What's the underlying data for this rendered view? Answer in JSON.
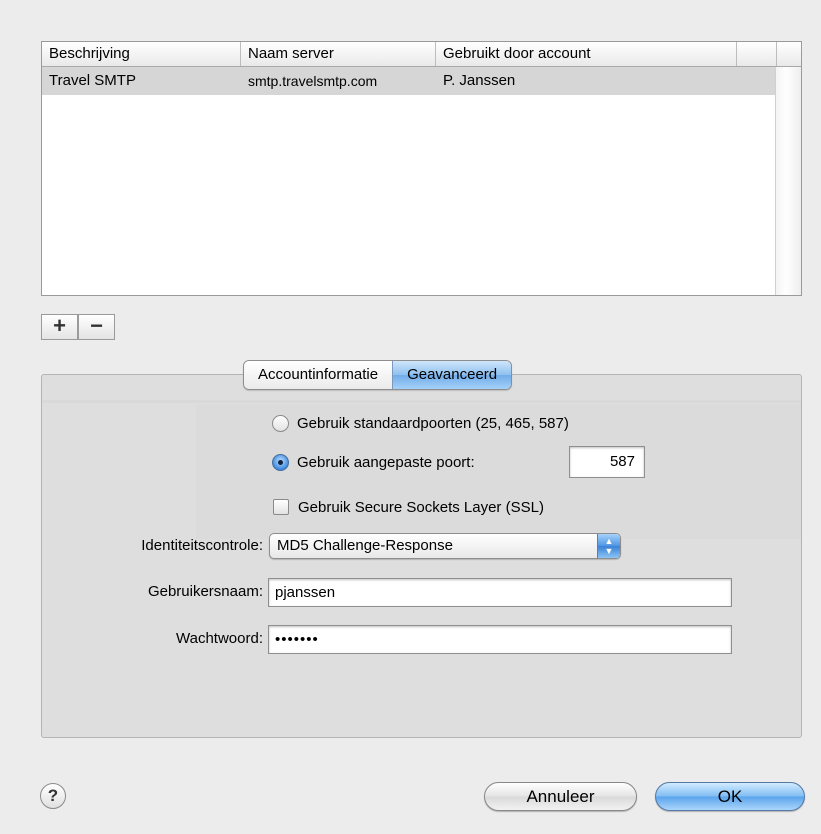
{
  "table": {
    "headers": [
      "Beschrijving",
      "Naam server",
      "Gebruikt door account"
    ],
    "rows": [
      {
        "description": "Travel SMTP",
        "server": "smtp.travelsmtp.com",
        "account": "P. Janssen"
      }
    ]
  },
  "list_buttons": {
    "add": "+",
    "remove": "−"
  },
  "tabs": [
    {
      "label": "Accountinformatie",
      "active": false
    },
    {
      "label": "Geavanceerd",
      "active": true
    }
  ],
  "ports": {
    "default_label": "Gebruik standaardpoorten (25, 465, 587)",
    "custom_label": "Gebruik aangepaste poort:",
    "custom_selected": true,
    "custom_value": "587"
  },
  "ssl": {
    "label": "Gebruik Secure Sockets Layer (SSL)",
    "checked": false
  },
  "auth": {
    "label": "Identiteitscontrole:",
    "value": "MD5 Challenge-Response"
  },
  "username": {
    "label": "Gebruikersnaam:",
    "value": "pjanssen"
  },
  "password": {
    "label": "Wachtwoord:",
    "value": "•••••••"
  },
  "footer": {
    "help": "?",
    "cancel": "Annuleer",
    "ok": "OK"
  },
  "colors": {
    "accent": "#5aa3ec",
    "selection": "#d6d6d6"
  }
}
